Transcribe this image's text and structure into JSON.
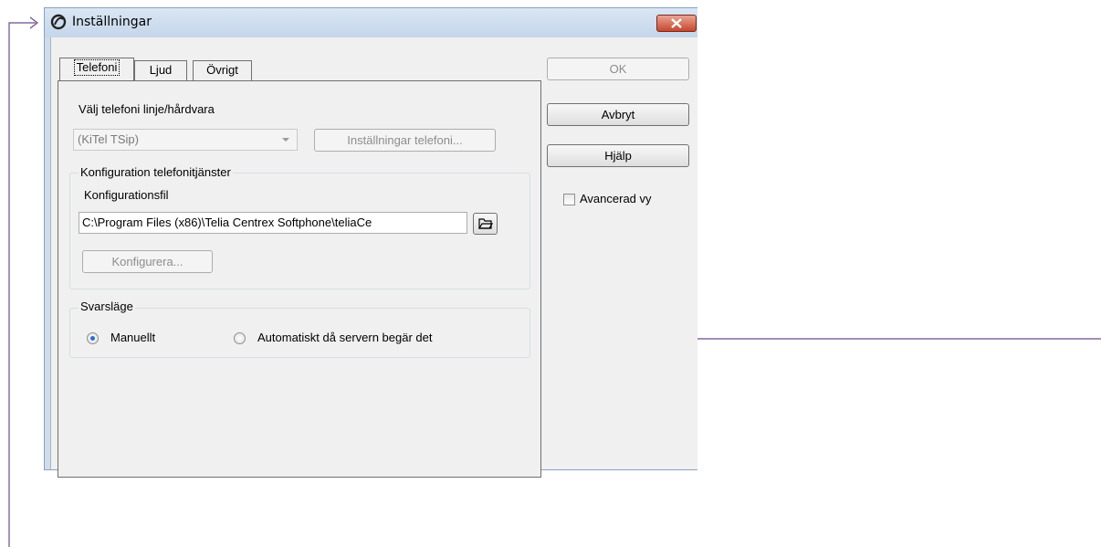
{
  "window": {
    "title": "Inställningar",
    "close_icon": "close-icon"
  },
  "tabs": [
    {
      "label": "Telefoni",
      "active": true
    },
    {
      "label": "Ljud",
      "active": false
    },
    {
      "label": "Övrigt",
      "active": false
    }
  ],
  "telephony": {
    "select_label": "Välj telefoni linje/hårdvara",
    "line_value": "(KiTel TSip)",
    "settings_button": "Inställningar telefoni..."
  },
  "config": {
    "group_title": "Konfiguration telefonitjänster",
    "file_label": "Konfigurationsfil",
    "file_value": "C:\\Program Files (x86)\\Telia Centrex Softphone\\teliaCe",
    "browse_icon": "folder-open-icon",
    "configure_button": "Konfigurera..."
  },
  "answer_mode": {
    "group_title": "Svarsläge",
    "options": [
      {
        "label": "Manuellt",
        "checked": true
      },
      {
        "label": "Automatiskt då servern begär det",
        "checked": false
      }
    ]
  },
  "buttons": {
    "ok": "OK",
    "cancel": "Avbryt",
    "help": "Hjälp"
  },
  "advanced_view": {
    "label": "Avancerad vy",
    "checked": false
  },
  "colors": {
    "annotation_line": "#6b4c8a",
    "radio_selected": "#2b6fcf"
  }
}
